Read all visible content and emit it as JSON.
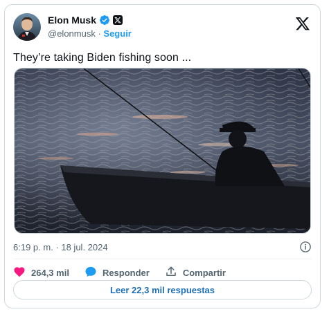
{
  "author": {
    "display_name": "Elon Musk",
    "handle": "@elonmusk",
    "separator": " · ",
    "follow_label": "Seguir"
  },
  "tweet": {
    "text": "They’re taking Biden fishing soon ..."
  },
  "meta": {
    "timestamp": "6:19 p. m. · 18 jul. 2024"
  },
  "actions": {
    "likes_count": "264,3 mil",
    "reply_label": "Responder",
    "share_label": "Compartir"
  },
  "read_replies_label": "Leer 22,3 mil respuestas",
  "colors": {
    "accent": "#1d9bf0",
    "like": "#f91880",
    "reply": "#1d9bf0",
    "text_secondary": "#536471",
    "border": "#cfd9de"
  },
  "icons": {
    "verified": "verified-badge-icon",
    "x_badge": "x-affiliate-icon",
    "x_logo": "x-logo-icon",
    "info": "info-icon",
    "like": "heart-icon",
    "reply": "speech-bubble-icon",
    "share": "share-icon"
  }
}
